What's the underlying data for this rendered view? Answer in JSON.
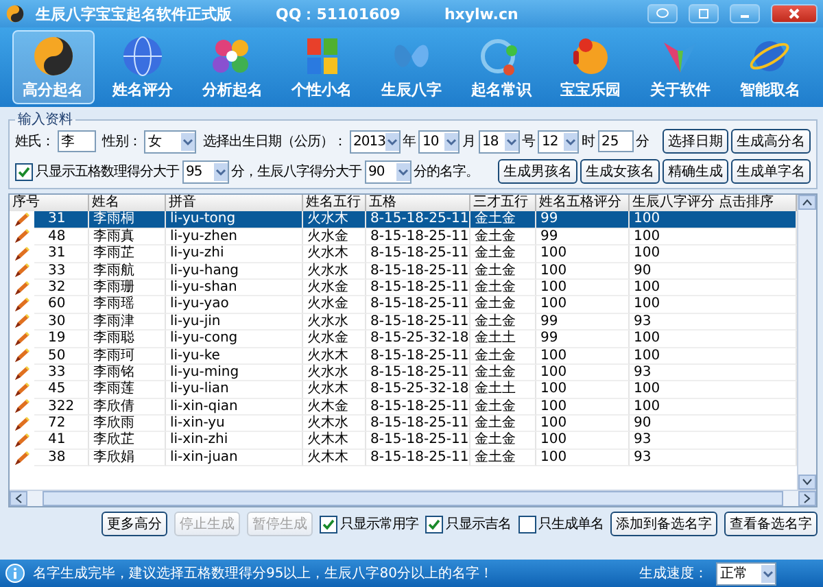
{
  "window": {
    "title": "生辰八字宝宝起名软件正式版",
    "qq": "QQ：51101609",
    "site": "hxylw.cn"
  },
  "toolbar": [
    {
      "label": "高分起名",
      "selected": true
    },
    {
      "label": "姓名评分",
      "selected": false
    },
    {
      "label": "分析起名",
      "selected": false
    },
    {
      "label": "个性小名",
      "selected": false
    },
    {
      "label": "生辰八字",
      "selected": false
    },
    {
      "label": "起名常识",
      "selected": false
    },
    {
      "label": "宝宝乐园",
      "selected": false
    },
    {
      "label": "关于软件",
      "selected": false
    },
    {
      "label": "智能取名",
      "selected": false
    }
  ],
  "input_panel": {
    "title": "输入资料",
    "surname_label": "姓氏：",
    "surname": "李",
    "gender_label": "性别：",
    "gender": "女",
    "date_label": "选择出生日期（公历）：",
    "year": "2013",
    "year_unit": "年",
    "month": "10",
    "month_unit": "月",
    "day": "18",
    "day_unit": "号",
    "hour": "12",
    "hour_unit": "时",
    "minute": "25",
    "minute_unit": "分",
    "buttons_top": [
      "选择日期",
      "生成高分名"
    ],
    "filter": {
      "checked": true,
      "text_1": "只显示五格数理得分大于",
      "score_1": "95",
      "text_2": "分，生辰八字得分大于",
      "score_2": "90",
      "text_3": "分的名字。"
    },
    "buttons_bottom": [
      "生成男孩名",
      "生成女孩名",
      "精确生成",
      "生成单字名"
    ]
  },
  "table": {
    "columns": [
      "序号",
      "姓名",
      "拼音",
      "姓名五行",
      "五格",
      "三才五行",
      "姓名五格评分",
      "生辰八字评分 点击排序"
    ],
    "rows": [
      {
        "selected": true,
        "cells": [
          "31",
          "李雨桐",
          "li-yu-tong",
          "火水木",
          "8-15-18-25-11",
          "金土金",
          "99",
          "100"
        ]
      },
      {
        "selected": false,
        "cells": [
          "48",
          "李雨真",
          "li-yu-zhen",
          "火水金",
          "8-15-18-25-11",
          "金土金",
          "99",
          "100"
        ]
      },
      {
        "selected": false,
        "cells": [
          "31",
          "李雨芷",
          "li-yu-zhi",
          "火水木",
          "8-15-18-25-11",
          "金土金",
          "100",
          "100"
        ]
      },
      {
        "selected": false,
        "cells": [
          "33",
          "李雨航",
          "li-yu-hang",
          "火水水",
          "8-15-18-25-11",
          "金土金",
          "100",
          "90"
        ]
      },
      {
        "selected": false,
        "cells": [
          "32",
          "李雨珊",
          "li-yu-shan",
          "火水金",
          "8-15-18-25-11",
          "金土金",
          "100",
          "100"
        ]
      },
      {
        "selected": false,
        "cells": [
          "60",
          "李雨瑶",
          "li-yu-yao",
          "火水金",
          "8-15-18-25-11",
          "金土金",
          "100",
          "100"
        ]
      },
      {
        "selected": false,
        "cells": [
          "30",
          "李雨津",
          "li-yu-jin",
          "火水水",
          "8-15-18-25-11",
          "金土金",
          "99",
          "93"
        ]
      },
      {
        "selected": false,
        "cells": [
          "19",
          "李雨聪",
          "li-yu-cong",
          "火水金",
          "8-15-25-32-18",
          "金土土",
          "99",
          "100"
        ]
      },
      {
        "selected": false,
        "cells": [
          "50",
          "李雨珂",
          "li-yu-ke",
          "火水木",
          "8-15-18-25-11",
          "金土金",
          "100",
          "100"
        ]
      },
      {
        "selected": false,
        "cells": [
          "33",
          "李雨铭",
          "li-yu-ming",
          "火水水",
          "8-15-18-25-11",
          "金土金",
          "100",
          "93"
        ]
      },
      {
        "selected": false,
        "cells": [
          "45",
          "李雨莲",
          "li-yu-lian",
          "火水木",
          "8-15-25-32-18",
          "金土土",
          "100",
          "100"
        ]
      },
      {
        "selected": false,
        "cells": [
          "322",
          "李欣倩",
          "li-xin-qian",
          "火木金",
          "8-15-18-25-11",
          "金土金",
          "100",
          "100"
        ]
      },
      {
        "selected": false,
        "cells": [
          "72",
          "李欣雨",
          "li-xin-yu",
          "火木水",
          "8-15-18-25-11",
          "金土金",
          "100",
          "90"
        ]
      },
      {
        "selected": false,
        "cells": [
          "41",
          "李欣芷",
          "li-xin-zhi",
          "火木木",
          "8-15-18-25-11",
          "金土金",
          "100",
          "93"
        ]
      },
      {
        "selected": false,
        "cells": [
          "38",
          "李欣娟",
          "li-xin-juan",
          "火木木",
          "8-15-18-25-11",
          "金土金",
          "100",
          "93"
        ]
      }
    ]
  },
  "actions": [
    {
      "kind": "button",
      "label": "更多高分",
      "disabled": false
    },
    {
      "kind": "button",
      "label": "停止生成",
      "disabled": true
    },
    {
      "kind": "button",
      "label": "暂停生成",
      "disabled": true
    },
    {
      "kind": "checkbox",
      "label": "只显示常用字",
      "checked": true
    },
    {
      "kind": "checkbox",
      "label": "只显示吉名",
      "checked": true
    },
    {
      "kind": "checkbox",
      "label": "只生成单名",
      "checked": false
    },
    {
      "kind": "button",
      "label": "添加到备选名字",
      "disabled": false
    },
    {
      "kind": "button",
      "label": "查看备选名字",
      "disabled": false
    }
  ],
  "status_bar": {
    "message": "名字生成完毕，建议选择五格数理得分95以上，生辰八字80分以上的名字！",
    "speed_label": "生成速度：",
    "speed": "正常"
  }
}
